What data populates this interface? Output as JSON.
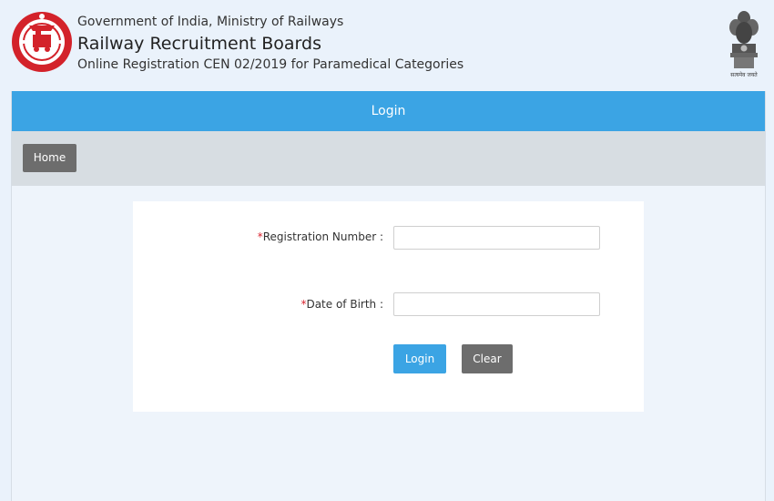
{
  "header": {
    "line1": "Government of India, Ministry of Railways",
    "line2": "Railway Recruitment Boards",
    "line3": "Online Registration CEN 02/2019 for Paramedical Categories",
    "emblem_caption": "सत्यमेव जयते"
  },
  "panel": {
    "title": "Login"
  },
  "nav": {
    "home_label": "Home"
  },
  "form": {
    "reg_label": "Registration Number :",
    "reg_value": "",
    "dob_label": "Date of Birth :",
    "dob_value": "",
    "required_mark": "*",
    "login_label": "Login",
    "clear_label": "Clear"
  },
  "colors": {
    "accent": "#3ba4e4",
    "button_gray": "#6d6d6d",
    "required": "#d9232e",
    "logo_red": "#d3222a"
  },
  "icons": {
    "left_logo": "indian-railways-logo",
    "right_logo": "ashoka-emblem"
  }
}
